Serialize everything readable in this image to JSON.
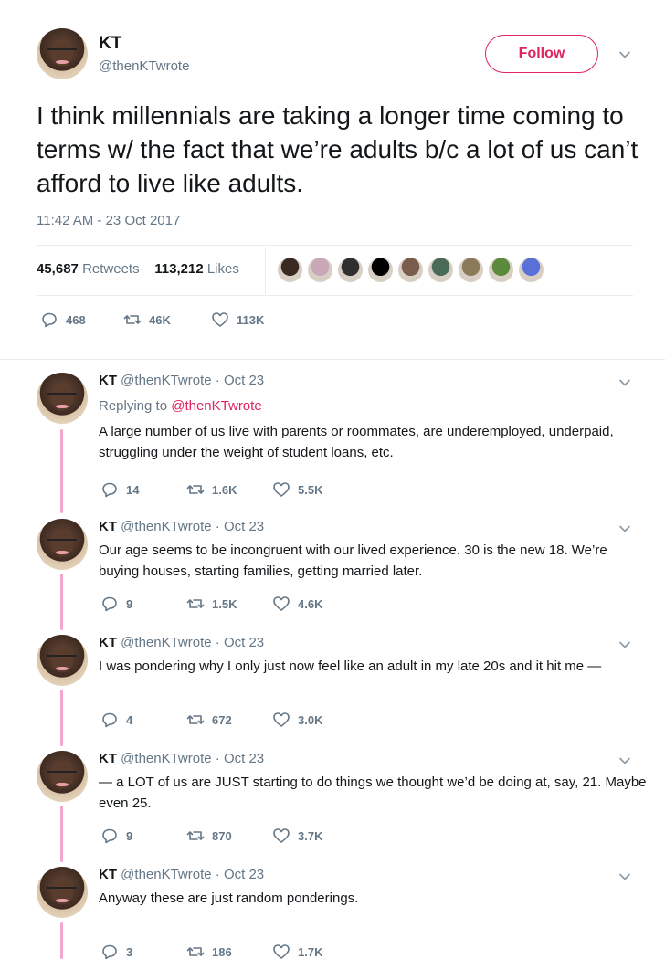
{
  "main": {
    "name": "KT",
    "handle": "@thenKTwrote",
    "follow_label": "Follow",
    "text": "I think millennials are taking a longer time coming to terms w/ the fact that we’re adults b/c a lot of us can’t afford to live like adults.",
    "timestamp": "11:42 AM - 23 Oct 2017",
    "retweets_count": "45,687",
    "retweets_label": "Retweets",
    "likes_count": "113,212",
    "likes_label": "Likes",
    "replies": "468",
    "retweets": "46K",
    "likes": "113K"
  },
  "liker_colors": [
    "#3a2a22",
    "#c9a6b8",
    "#2f2f2f",
    "#000000",
    "#7a5c4c",
    "#4a6b58",
    "#8a7a5a",
    "#5b8a3a",
    "#5a6fd8"
  ],
  "replies": [
    {
      "name": "KT",
      "meta": "@thenKTwrote · Oct 23",
      "replying_prefix": "Replying to",
      "replying_handle": "@thenKTwrote",
      "text": "A large number of us live with parents or roommates, are underemployed, underpaid, struggling under the weight of student loans, etc.",
      "replies": "14",
      "retweets": "1.6K",
      "likes": "5.5K"
    },
    {
      "name": "KT",
      "meta": "@thenKTwrote · Oct 23",
      "text": "Our age seems to be incongruent with our lived experience. 30 is the new 18. We’re buying houses, starting families, getting married later.",
      "replies": "9",
      "retweets": "1.5K",
      "likes": "4.6K"
    },
    {
      "name": "KT",
      "meta": "@thenKTwrote · Oct 23",
      "text": "I was pondering why I only just now feel like an adult in my late 20s and it hit me —",
      "replies": "4",
      "retweets": "672",
      "likes": "3.0K"
    },
    {
      "name": "KT",
      "meta": "@thenKTwrote · Oct 23",
      "text": "— a LOT of us are JUST starting to do things we thought we’d be doing at, say, 21. Maybe even 25.",
      "replies": "9",
      "retweets": "870",
      "likes": "3.7K"
    },
    {
      "name": "KT",
      "meta": "@thenKTwrote · Oct 23",
      "text": "Anyway these are just random ponderings.",
      "replies": "3",
      "retweets": "186",
      "likes": "1.7K"
    }
  ],
  "colors": {
    "accent": "#e0245e",
    "muted": "#657786",
    "thread": "#f5a6cf"
  }
}
